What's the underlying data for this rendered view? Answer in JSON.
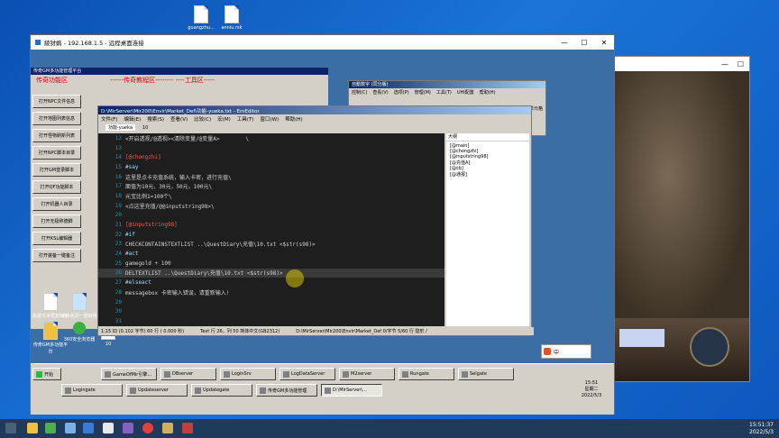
{
  "desktop": {
    "icons": [
      {
        "label": "guangzhu...",
        "name": "desktop-file-guangzhu"
      },
      {
        "label": "anniu.rsk",
        "name": "desktop-file-anniu"
      }
    ]
  },
  "remote": {
    "title": "綾犲嬀 - 192.168.1.5 - 远程桌面连接",
    "controls": {
      "min": "—",
      "max": "☐",
      "close": "✕"
    }
  },
  "inner": {
    "panel_title": "传奇GM多功能管理平台",
    "banner": {
      "left": "传奇功能区",
      "center": "------传奇教程区-------- ----工具区-----"
    },
    "func_buttons": [
      "打开NPC文件信息",
      "打开地图列表信息",
      "打开怪物刷新列表",
      "打开NPC脚本目录",
      "打开GM登录脚本",
      "打开QF功能脚本",
      "打开机器人目录",
      "打开无极称德脚",
      "打开KSL编辑器",
      "打开装备一键备注"
    ],
    "desk_icons": [
      {
        "label": "新建文本框复制形",
        "name": "inner-icon-newtext"
      },
      {
        "label": "256色调一键转换",
        "name": "inner-icon-256"
      },
      {
        "label": "传奇GM多功能平台",
        "name": "inner-icon-gmplatform"
      },
      {
        "label": "360安全浏览器",
        "name": "inner-icon-360"
      },
      {
        "label": "10",
        "name": "inner-icon-10"
      }
    ]
  },
  "numwin": {
    "title": "自動数字 (同分版)",
    "menu": [
      "控制(C)",
      "查看(V)",
      "选项(P)",
      "管理(M)",
      "工具(T)",
      "UHI配置",
      "帮助(H)"
    ],
    "bottom": "单元格"
  },
  "editor": {
    "title": "D:\\MirServer\\Mir200\\Envir\\Market_Def\\功能-yueka.txt - EmEditor",
    "menu": [
      "文件(F)",
      "编辑(E)",
      "搜索(S)",
      "查看(V)",
      "比较(C)",
      "宏(M)",
      "工具(T)",
      "窗口(W)",
      "帮助(H)"
    ],
    "tabs": [
      "功能-yueka",
      "10"
    ],
    "outline_title": "大纲",
    "outline_items": [
      "[@main]",
      "[@chongzhi]",
      "[@inputstring98]",
      "[@充值A]",
      "[@cb]",
      "[@通报]"
    ],
    "lines": [
      {
        "n": "12",
        "t": "<开启透视/@透视><清除变量/@变量A>        \\",
        "c": ""
      },
      {
        "n": "13",
        "t": "",
        "c": ""
      },
      {
        "n": "14",
        "t": "[@chongzhi]",
        "c": "red"
      },
      {
        "n": "15",
        "t": "#say",
        "c": "blue"
      },
      {
        "n": "16",
        "t": "这里是点卡充值系统，输入卡密，进行充值\\",
        "c": ""
      },
      {
        "n": "17",
        "t": "面值为10元，30元，50元，100元\\",
        "c": ""
      },
      {
        "n": "18",
        "t": "元宝比例1=100个\\",
        "c": ""
      },
      {
        "n": "19",
        "t": "<点这里充值/@@inputstring98>\\",
        "c": ""
      },
      {
        "n": "20",
        "t": "",
        "c": ""
      },
      {
        "n": "21",
        "t": "[@inputstring98]",
        "c": "red"
      },
      {
        "n": "22",
        "t": "#if",
        "c": "blue"
      },
      {
        "n": "23",
        "t": "CHECKCONTAINSTEXTLIST ..\\QuestDiary\\充值\\10.txt <$str(s98)>",
        "c": ""
      },
      {
        "n": "24",
        "t": "#act",
        "c": "blue"
      },
      {
        "n": "25",
        "t": "gamegold + 100",
        "c": ""
      },
      {
        "n": "26",
        "t": "DELTEXTLIST ..\\QuestDiary\\充值\\10.txt <$str(s98)>",
        "c": "",
        "sel": true
      },
      {
        "n": "27",
        "t": "#elseact",
        "c": "blue"
      },
      {
        "n": "28",
        "t": "messagebox 卡密输入错误，请重新输入!",
        "c": ""
      },
      {
        "n": "29",
        "t": "",
        "c": ""
      },
      {
        "n": "30",
        "t": "",
        "c": ""
      },
      {
        "n": "31",
        "t": "",
        "c": ""
      },
      {
        "n": "32",
        "t": "[@充值A]",
        "c": "red"
      },
      {
        "n": "33",
        "t": "#act",
        "c": "blue"
      }
    ],
    "status": {
      "pos": "1:15 ID (0.102 字节) 60 行 ( 0.000 秒)",
      "encoding": "Text 行 26，列 50 简体中文(GB2312)",
      "path": "D:\\MirServer\\Mir200\\Envir\\Market_Def 0/字节 5/60 行 隐形 /"
    }
  },
  "inner_taskbar": {
    "start": "开始",
    "row1": [
      "GameOfMir引擎...",
      "DBserver",
      "LoginSrv",
      "LogDataServer",
      "M2server",
      "Rungate",
      "Selgate"
    ],
    "row2": [
      "Logingate",
      "Updateserver",
      "Updategate",
      "传奇GM多功能管理",
      "D:\\MirServer\\..."
    ],
    "clock": {
      "time": "15:51",
      "day": "星期二",
      "date": "2022/5/3"
    },
    "ime": "中"
  },
  "host_taskbar": {
    "time": "15:51:37",
    "date": "2022/5/3"
  },
  "colors": {
    "code_bg": "#1e1e1e",
    "accent_red": "#e00000",
    "desktop_blue": "#1464c8"
  }
}
